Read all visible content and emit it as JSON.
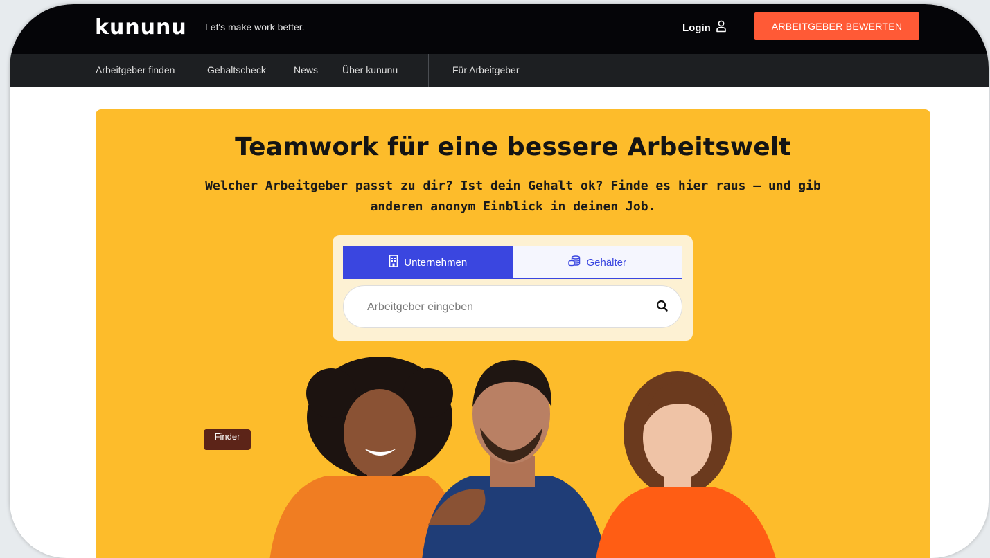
{
  "header": {
    "logo": "kununu",
    "tagline": "Let's make work better.",
    "login_label": "Login",
    "cta_label": "ARBEITGEBER BEWERTEN"
  },
  "nav": {
    "items": [
      {
        "label": "Arbeitgeber finden"
      },
      {
        "label": "Gehaltscheck"
      },
      {
        "label": "News"
      },
      {
        "label": "Über kununu"
      },
      {
        "label": "Für Arbeitgeber"
      }
    ]
  },
  "hero": {
    "headline": "Teamwork für eine bessere Arbeitswelt",
    "subline": "Welcher Arbeitgeber passt zu dir? Ist dein Gehalt ok? Finde es hier raus – und gib anderen anonym Einblick in deinen Job.",
    "tabs": [
      {
        "label": "Unternehmen",
        "icon": "building-icon",
        "active": true
      },
      {
        "label": "Gehälter",
        "icon": "coins-icon",
        "active": false
      }
    ],
    "search": {
      "placeholder": "Arbeitgeber eingeben",
      "value": ""
    },
    "tooltip": "Finder"
  },
  "colors": {
    "topbar": "#050508",
    "navbar": "#1d1f22",
    "accent_cta": "#ff5a36",
    "hero_bg": "#fdbc2b",
    "tab_active": "#3a46e0"
  }
}
